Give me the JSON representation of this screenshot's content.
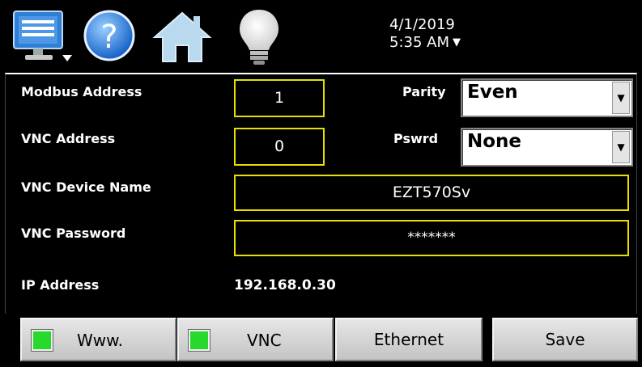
{
  "header": {
    "date": "4/1/2019",
    "time": "5:35 AM",
    "time_dropdown_glyph": "▼",
    "icons": [
      "monitor-menu-icon",
      "help-icon",
      "home-icon",
      "lightbulb-icon"
    ]
  },
  "form": {
    "modbus_label": "Modbus Address",
    "modbus_value": "1",
    "parity_label": "Parity",
    "parity_value": "Even",
    "vnc_address_label": "VNC Address",
    "vnc_address_value": "0",
    "pswrd_label": "Pswrd",
    "pswrd_value": "None",
    "device_name_label": "VNC Device Name",
    "device_name_value": "EZT570Sv",
    "vnc_password_label": "VNC Password",
    "vnc_password_value": "*******",
    "ip_label": "IP Address",
    "ip_value": "192.168.0.30"
  },
  "buttons": {
    "www_label": "Www.",
    "vnc_label": "VNC",
    "ethernet_label": "Ethernet",
    "save_label": "Save"
  },
  "colors": {
    "field_border": "#e8e000",
    "led_green": "#27d92a",
    "background": "#000000"
  }
}
